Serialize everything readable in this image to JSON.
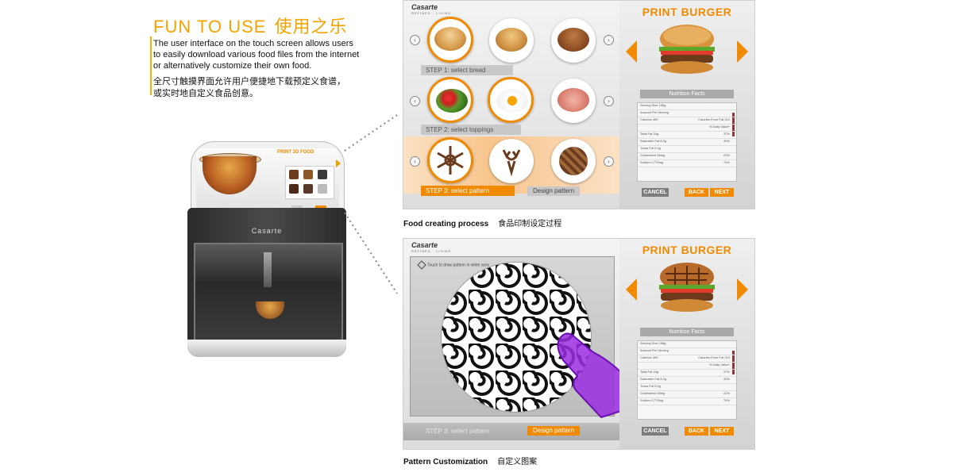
{
  "intro": {
    "title_en": "FUN TO USE",
    "title_cn": "使用之乐",
    "desc_en": "The user interface on the touch screen allows users to easily download various food files from the internet or alternatively customize their own food.",
    "desc_cn": "全尺寸触摸界面允许用户便捷地下载预定义食谱，或实时地自定义食品创意。"
  },
  "printer": {
    "logo": "Casarte",
    "screen_title": "PRINT 3D FOOD"
  },
  "screen1": {
    "brand": "Casarte",
    "brand_sub": "REFINED · LIVING",
    "steps": [
      {
        "label": "STEP 1: select bread"
      },
      {
        "label": "STEP 2: select toppings"
      },
      {
        "label": "STEP 3: select pattern"
      }
    ],
    "design_pattern": "Design pattern",
    "rows": [
      {
        "items": [
          "sesame-bun-icon",
          "plain-bun-icon",
          "dark-bun-icon"
        ]
      },
      {
        "items": [
          "salad-icon",
          "fried-egg-icon",
          "ham-slices-icon"
        ]
      },
      {
        "items": [
          "snowflake-pattern-icon",
          "deer-pattern-icon",
          "waffle-pattern-icon"
        ]
      }
    ],
    "right": {
      "title": "PRINT BURGER",
      "nutrition_title": "Nutrition Facts",
      "nutrition_rows": [
        {
          "label": "Serving Size 198g",
          "value": ""
        },
        {
          "label": "Amount Per Serving",
          "value": ""
        },
        {
          "label": "Calories 490",
          "value": "Calories From Fat 210"
        },
        {
          "label": "",
          "value": "% Daily Value*"
        },
        {
          "label": "Total Fat 24g",
          "value": "37%"
        },
        {
          "label": "Saturated Fat 8.0g",
          "value": "40%"
        },
        {
          "label": "Trans Fat 0.0g",
          "value": ""
        },
        {
          "label": "Cholesterol 65mg",
          "value": "22%"
        },
        {
          "label": "Sodium 1770mg",
          "value": "74%"
        }
      ],
      "cancel": "CANCEL",
      "back": "BACK",
      "next": "NEXT"
    }
  },
  "caption1": {
    "en": "Food creating process",
    "cn": "食品印制设定过程"
  },
  "screen2": {
    "brand": "Casarte",
    "brand_sub": "REFINED · LIVING",
    "touch_hint": "Touch to draw pattern in white area",
    "step": "STEP 3: select pattern",
    "design_pattern": "Design pattern",
    "right": {
      "title": "PRINT BURGER",
      "nutrition_title": "Nutrition Facts",
      "cancel": "CANCEL",
      "back": "BACK",
      "next": "NEXT"
    }
  },
  "caption2": {
    "en": "Pattern Customization",
    "cn": "自定义图案"
  },
  "colors": {
    "accent": "#f08a00",
    "title_gold": "#f5a300"
  }
}
